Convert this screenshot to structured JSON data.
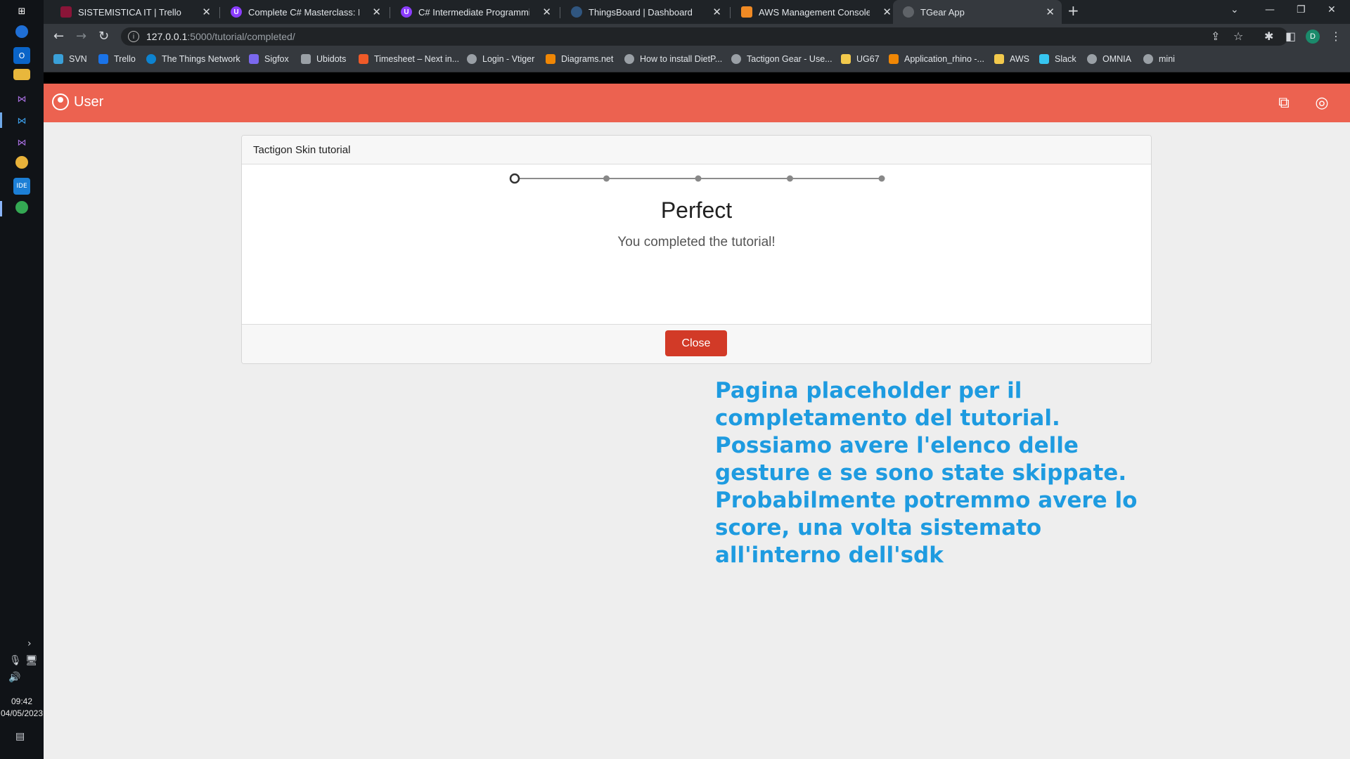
{
  "browser": {
    "tabs": [
      {
        "title": "SISTEMISTICA IT | Trello",
        "favicon": "trello-icon",
        "color": "#8a1538"
      },
      {
        "title": "Complete C# Masterclass: Learn the",
        "favicon": "udemy-icon",
        "color": "#8b3dff"
      },
      {
        "title": "C# Intermediate Programming: Classe",
        "favicon": "udemy-icon",
        "color": "#8b3dff"
      },
      {
        "title": "ThingsBoard | Dashboard",
        "favicon": "thingsboard-icon",
        "color": "#305680"
      },
      {
        "title": "AWS Management Console",
        "favicon": "aws-icon",
        "color": "#f08a24"
      },
      {
        "title": "TGear App",
        "favicon": "globe-icon",
        "color": "#5f6368"
      }
    ],
    "url_host": "127.0.0.1",
    "url_path": ":5000/tutorial/completed/",
    "profile_initial": "D",
    "bookmarks": [
      {
        "label": "SVN",
        "color": "#3aa0d8"
      },
      {
        "label": "Trello",
        "color": "#1a73e8"
      },
      {
        "label": "The Things Network",
        "color": "#0d83d0"
      },
      {
        "label": "Sigfox",
        "color": "#7b68ee"
      },
      {
        "label": "Ubidots",
        "color": "#9aa0a6"
      },
      {
        "label": "Timesheet – Next in...",
        "color": "#f05a28"
      },
      {
        "label": "Login - Vtiger",
        "color": "#9aa0a6"
      },
      {
        "label": "Diagrams.net",
        "color": "#f08705"
      },
      {
        "label": "How to install DietP...",
        "color": "#9aa0a6"
      },
      {
        "label": "Tactigon Gear - Use...",
        "color": "#9aa0a6"
      },
      {
        "label": "UG67",
        "color": "#f2c94c"
      },
      {
        "label": "Application_rhino -...",
        "color": "#f08705"
      },
      {
        "label": "AWS",
        "color": "#f2c94c"
      },
      {
        "label": "Slack",
        "color": "#36c5f0"
      },
      {
        "label": "OMNIA",
        "color": "#9aa0a6"
      },
      {
        "label": "mini",
        "color": "#9aa0a6"
      }
    ]
  },
  "taskbar": {
    "time": "09:42",
    "date": "04/05/2023"
  },
  "app": {
    "user_label": "User",
    "card_title": "Tactigon Skin tutorial",
    "steps_total": 5,
    "steps_current": 1,
    "done_title": "Perfect",
    "done_subtitle": "You completed the tutorial!",
    "close_label": "Close",
    "header_color": "#ec6250",
    "close_color": "#d23a27"
  },
  "annotation": "Pagina placeholder per il completamento del tutorial. Possiamo avere l'elenco delle gesture e se sono state skippate. Probabilmente potremmo avere lo score, una volta sistemato all'interno dell'sdk"
}
